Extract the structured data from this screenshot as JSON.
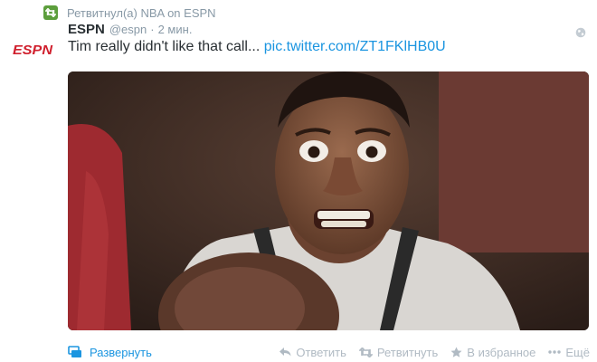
{
  "retweet": {
    "icon": "retweet-badge-icon",
    "text": "Ретвитнул(а) NBA on ESPN"
  },
  "tweet": {
    "logo_text": "ESPN",
    "name": "ESPN",
    "handle": "@espn",
    "separator": "·",
    "time": "2 мин.",
    "text": "Tim really didn't like that call... ",
    "link": "pic.twitter.com/ZT1FKlHB0U"
  },
  "actions": {
    "expand": "Развернуть",
    "reply": "Ответить",
    "retweet": "Ретвитнуть",
    "favorite": "В избранное",
    "more": "Ещё"
  },
  "colors": {
    "accent": "#1b95e0",
    "retweet_green": "#5c9e3c",
    "espn_red": "#d0202e",
    "muted": "#8899a6"
  }
}
